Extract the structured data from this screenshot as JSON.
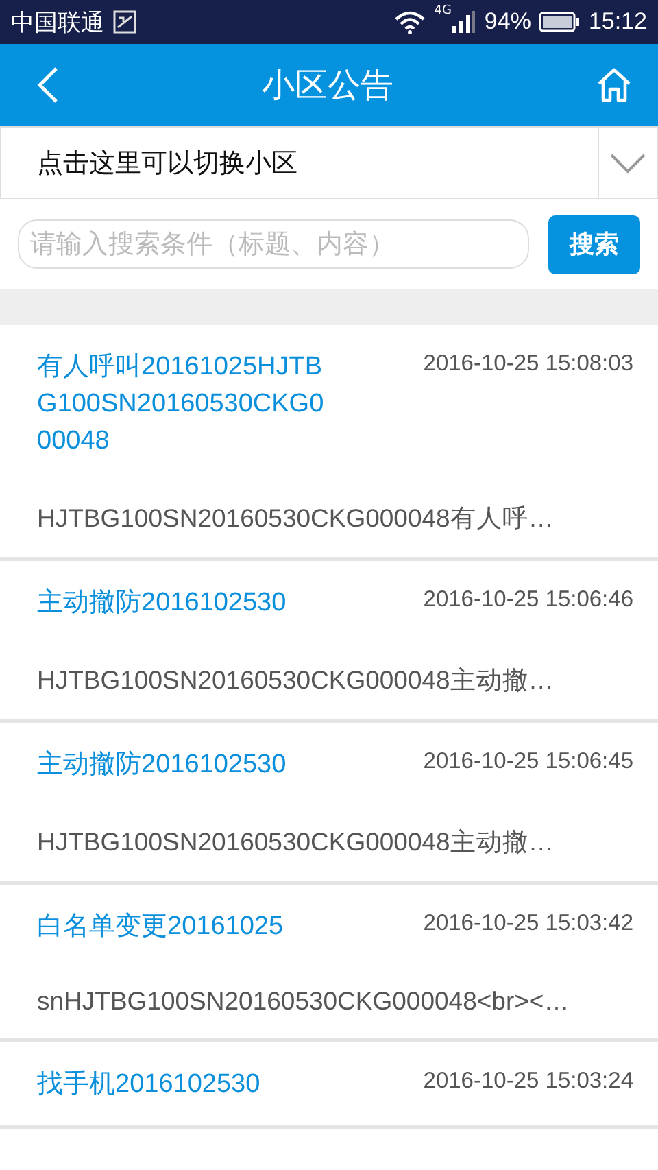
{
  "status_bar": {
    "carrier": "中国联通",
    "network": "4G",
    "battery": "94%",
    "time": "15:12"
  },
  "header": {
    "title": "小区公告"
  },
  "community_selector": {
    "label": "点击这里可以切换小区"
  },
  "search": {
    "placeholder": "请输入搜索条件（标题、内容）",
    "button": "搜索"
  },
  "notices": [
    {
      "title": "有人呼叫20161025HJTBG100SN20160530CKG000048",
      "time": "2016-10-25 15:08:03",
      "summary": "HJTBG100SN20160530CKG000048有人呼…"
    },
    {
      "title": "主动撤防2016102530",
      "time": "2016-10-25 15:06:46",
      "summary": "HJTBG100SN20160530CKG000048主动撤…"
    },
    {
      "title": "主动撤防2016102530",
      "time": "2016-10-25 15:06:45",
      "summary": "HJTBG100SN20160530CKG000048主动撤…"
    },
    {
      "title": "白名单变更20161025",
      "time": "2016-10-25 15:03:42",
      "summary": "snHJTBG100SN20160530CKG000048<br><…"
    },
    {
      "title": "找手机2016102530",
      "time": "2016-10-25 15:03:24"
    }
  ]
}
